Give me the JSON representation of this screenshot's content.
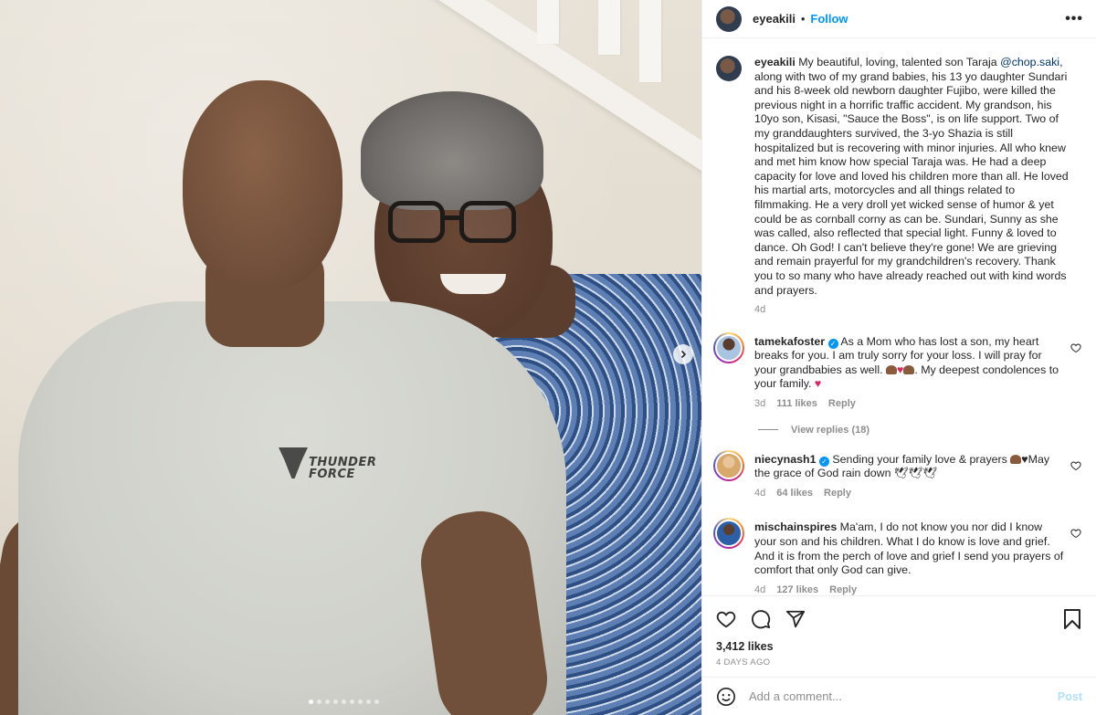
{
  "media": {
    "shirt_logo": [
      "THUNDER",
      "FORCE"
    ],
    "carousel_dot_count": 9,
    "carousel_active_index": 0
  },
  "header": {
    "username": "eyeakili",
    "separator": "•",
    "follow_label": "Follow",
    "more_label": "•••"
  },
  "caption": {
    "username": "eyeakili",
    "text_before_mention": " My beautiful, loving, talented son Taraja ",
    "mention": "@chop.saki",
    "text_after_mention": ", along with two of my grand babies, his 13 yo daughter Sundari and his 8-week old newborn daughter Fujibo, were killed the previous night in a horrific traffic accident. My grandson, his 10yo son, Kisasi, \"Sauce the Boss\", is on life support. Two of my granddaughters survived, the 3-yo Shazia is still hospitalized but is recovering with minor injuries. All who knew and met him know how special Taraja was. He had a deep capacity for love and loved his children more than all. He loved his martial arts, motorcycles and all things related to filmmaking. He a very droll yet wicked sense of humor & yet could be as cornball corny as can be. Sundari, Sunny as she was called, also reflected that special light. Funny & loved to dance. Oh God! I can't believe they're gone! We are grieving and remain prayerful for my grandchildren's recovery. Thank you to so many who have already reached out with kind words and prayers.",
    "age": "4d"
  },
  "comments": [
    {
      "username": "tamekafoster",
      "verified": true,
      "text_a": " As a Mom who has lost a son, my heart breaks for you. I am truly sorry for your loss. I will pray for your grandbabies as well. ",
      "text_b": ". My deepest condolences to your family. ",
      "age": "3d",
      "likes": "111 likes",
      "reply_label": "Reply",
      "view_replies": "View replies (18)"
    },
    {
      "username": "niecynash1",
      "verified": true,
      "text_a": " Sending your family love & prayers ",
      "text_b": "♥May the grace of God rain down 🕊🕊🕊",
      "age": "4d",
      "likes": "64 likes",
      "reply_label": "Reply"
    },
    {
      "username": "mischainspires",
      "verified": false,
      "text_a": " Ma'am, I do not know you nor did I know your son and his children. What I do know is love and grief. And it is from the perch of love and grief I send you prayers of comfort that only God can give.",
      "age": "4d",
      "likes": "127 likes",
      "reply_label": "Reply"
    }
  ],
  "actions": {
    "icons": [
      "heart-icon",
      "comment-icon",
      "share-icon",
      "bookmark-icon"
    ],
    "likes": "3,412 likes",
    "date": "4 DAYS AGO"
  },
  "composer": {
    "placeholder": "Add a comment...",
    "post_label": "Post"
  },
  "colors": {
    "link": "#0095f6",
    "mention": "#00376b",
    "muted": "#8e8e8e",
    "text": "#262626",
    "post_disabled": "#b2dffc",
    "heart": "#e0245e"
  }
}
